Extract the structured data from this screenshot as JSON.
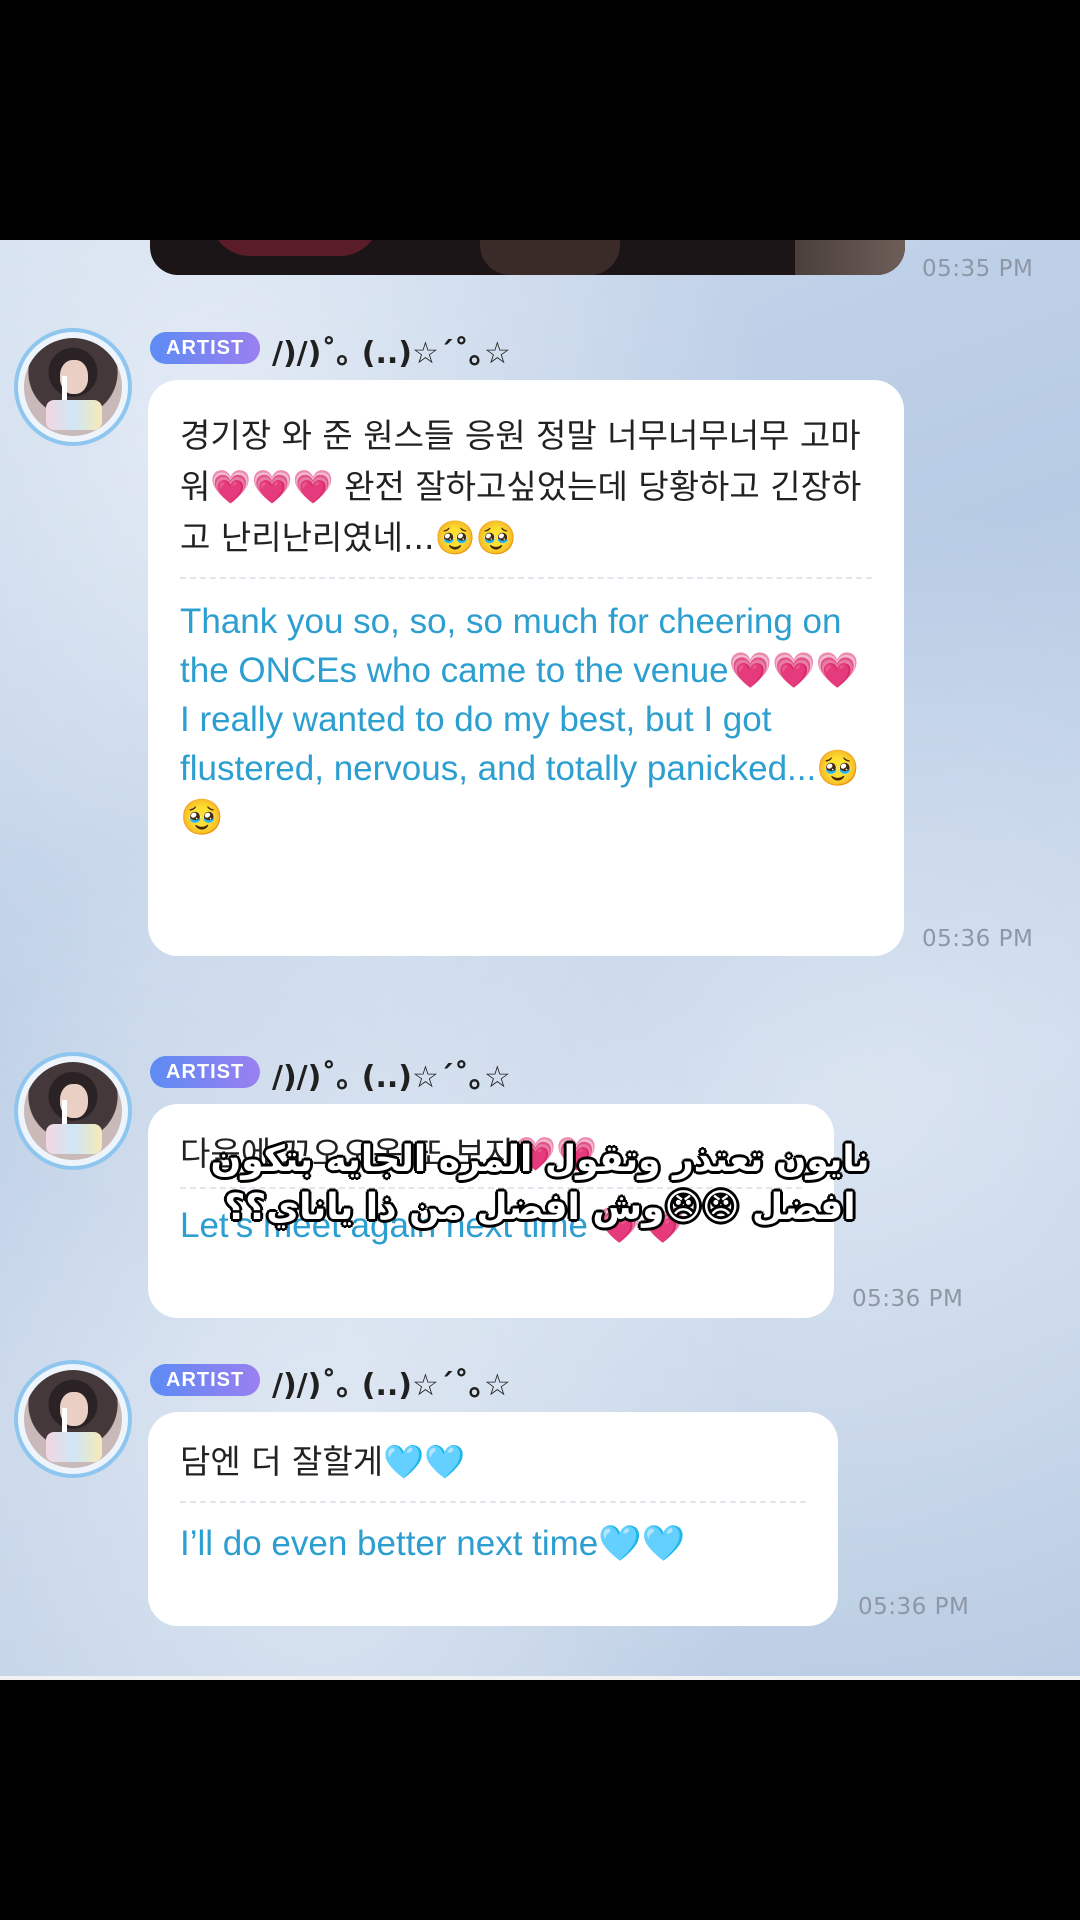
{
  "chat": {
    "photo_timestamp": "05:35 PM",
    "messages": [
      {
        "badge": "ARTIST",
        "sender": "/)/)˚｡ (..)☆´˚｡☆",
        "korean": "경기장 와 준 원스들 응원 정말 너무너무너무 고마워💗💗💗 완전 잘하고싶었는데 당황하고 긴장하고 난리난리였네...🥹🥹",
        "english": "Thank you so, so, so much for cheering on the ONCEs who came to the venue💗💗💗 I really wanted to do my best, but I got flustered, nervous, and totally panicked...🥹🥹",
        "timestamp": "05:36 PM"
      },
      {
        "badge": "ARTIST",
        "sender": "/)/)˚｡ (..)☆´˚｡☆",
        "korean": "다음에 꼬오오옥 또 보자💗💗",
        "english": "Let’s meet again next time 💗💗",
        "timestamp": "05:36 PM"
      },
      {
        "badge": "ARTIST",
        "sender": "/)/)˚｡ (..)☆´˚｡☆",
        "korean": "담엔 더 잘할게🩵🩵",
        "english": "I’ll do even better next time🩵🩵",
        "timestamp": "05:36 PM"
      }
    ]
  },
  "caption_overlay": {
    "line1": "نايون تعتذر وتقول المره الجايه بتكون",
    "line2": "افضل 😠😠وش افضل من ذا ياناي؟؟"
  },
  "colors": {
    "english_text": "#2c9fd0",
    "badge_gradient": [
      "#5d8bf4",
      "#9b7ff0"
    ],
    "avatar_ring": "#8ec6ef",
    "timestamp": "#8d97a6"
  },
  "icons": [
    "avatar-photo",
    "artist-badge"
  ]
}
